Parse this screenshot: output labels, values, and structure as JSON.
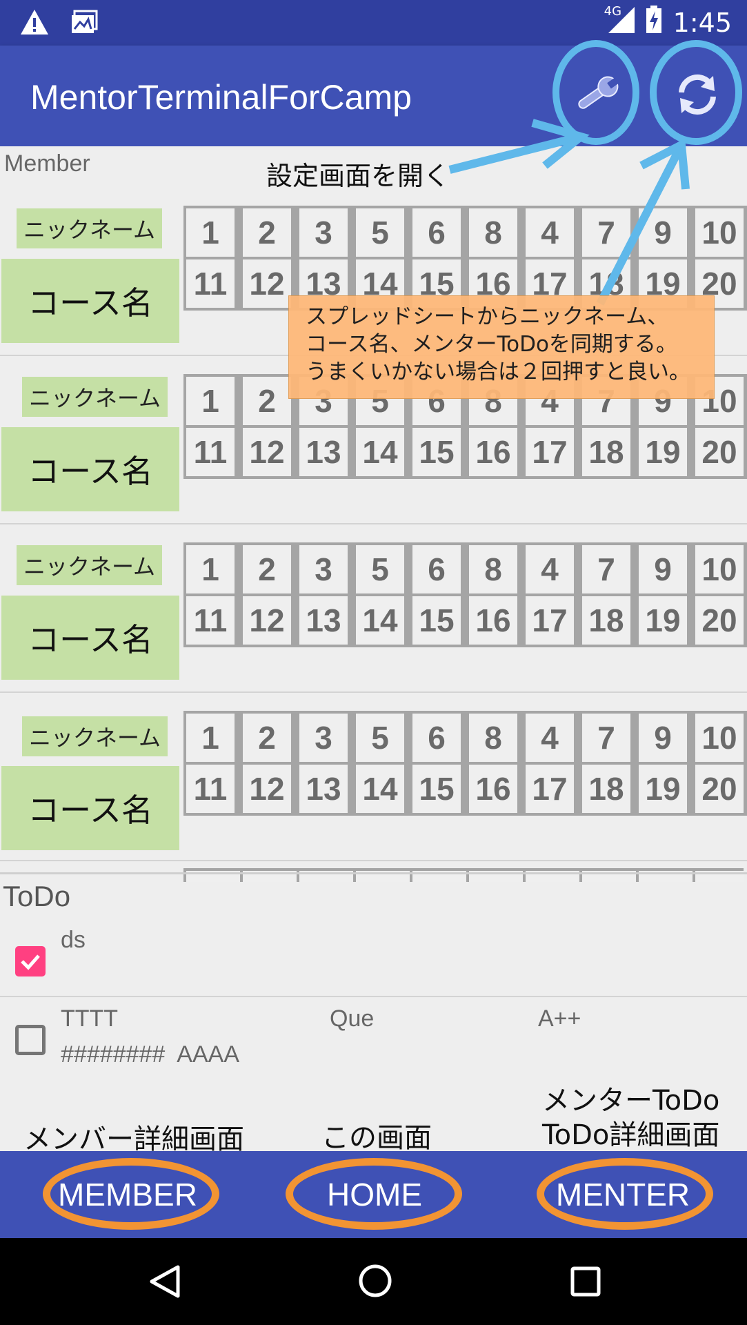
{
  "status_bar": {
    "time": "1:45",
    "network": "4G"
  },
  "app_bar": {
    "title": "MentorTerminalForCamp"
  },
  "member_section": {
    "label": "Member",
    "cards": [
      {
        "nickname": "ニックネーム",
        "course": "コース名",
        "numbers": [
          "1",
          "2",
          "3",
          "5",
          "6",
          "8",
          "4",
          "7",
          "9",
          "10",
          "11",
          "12",
          "13",
          "14",
          "15",
          "16",
          "17",
          "18",
          "19",
          "20"
        ]
      },
      {
        "nickname": "ニックネーム",
        "course": "コース名",
        "numbers": [
          "1",
          "2",
          "3",
          "5",
          "6",
          "8",
          "4",
          "7",
          "9",
          "10",
          "11",
          "12",
          "13",
          "14",
          "15",
          "16",
          "17",
          "18",
          "19",
          "20"
        ]
      },
      {
        "nickname": "ニックネーム",
        "course": "コース名",
        "numbers": [
          "1",
          "2",
          "3",
          "5",
          "6",
          "8",
          "4",
          "7",
          "9",
          "10",
          "11",
          "12",
          "13",
          "14",
          "15",
          "16",
          "17",
          "18",
          "19",
          "20"
        ]
      },
      {
        "nickname": "ニックネーム",
        "course": "コース名",
        "numbers": [
          "1",
          "2",
          "3",
          "5",
          "6",
          "8",
          "4",
          "7",
          "9",
          "10",
          "11",
          "12",
          "13",
          "14",
          "15",
          "16",
          "17",
          "18",
          "19",
          "20"
        ]
      }
    ]
  },
  "annotations": {
    "settings_hint": "設定画面を開く",
    "sync_hint_lines": [
      "スプレッドシートからニックネーム、",
      "コース名、メンターToDoを同期する。",
      "うまくいかない場合は２回押すと良い。"
    ],
    "member_hint": "メンバー詳細画面",
    "home_hint": "この画面",
    "menter_hint_lines": [
      "メンターToDo",
      "ToDo詳細画面"
    ]
  },
  "todo_section": {
    "label": "ToDo",
    "items": [
      {
        "checked": true,
        "title": "ds",
        "col2": "",
        "col3": "",
        "subtitle": ""
      },
      {
        "checked": false,
        "title": "TTTT",
        "col2": "Que",
        "col3": "A++",
        "subtitle": "########  AAAA"
      }
    ]
  },
  "bottom_nav": {
    "member": "MEMBER",
    "home": "HOME",
    "menter": "MENTER"
  },
  "colors": {
    "primary": "#3f51b5",
    "primary_dark": "#303f9f",
    "accent": "#ff4081",
    "annotation_blue": "#5fb8ea",
    "annotation_orange": "#f29433",
    "label_green": "#c5e0a5",
    "callout_orange": "#ffb877"
  },
  "icons": {
    "settings": "wrench-icon",
    "sync": "sync-icon"
  }
}
